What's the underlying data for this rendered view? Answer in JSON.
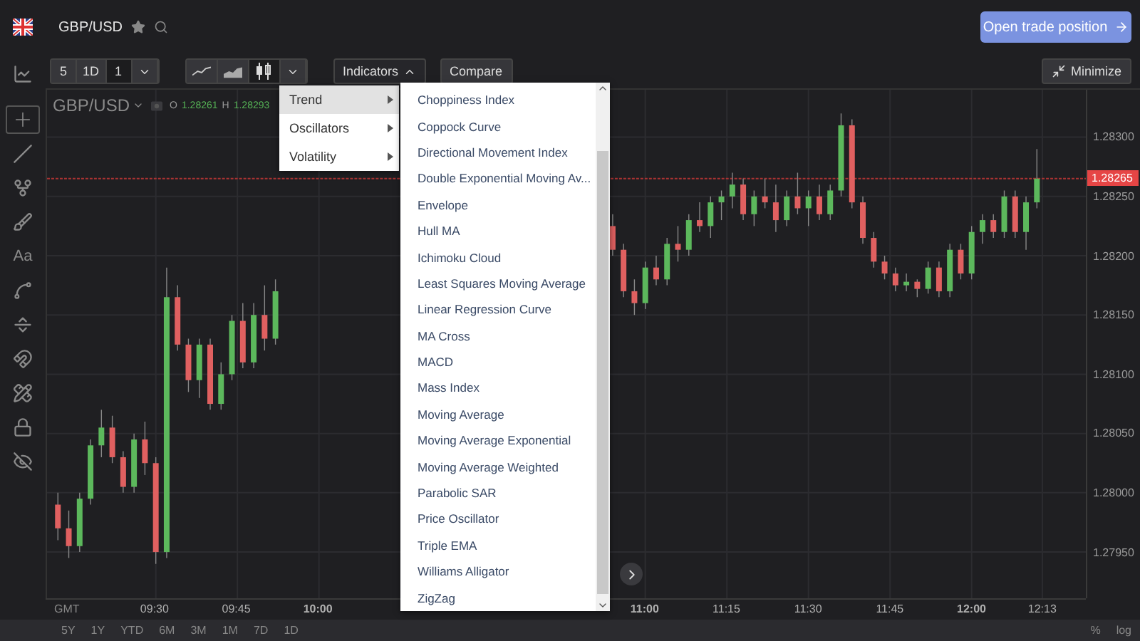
{
  "header": {
    "symbol": "GBP/USD",
    "cta": "Open trade position"
  },
  "toolbar": {
    "intervals": [
      {
        "label": "5",
        "selected": false
      },
      {
        "label": "1D",
        "selected": false
      },
      {
        "label": "1",
        "selected": true
      }
    ],
    "chart_types": [
      {
        "kind": "line",
        "selected": false
      },
      {
        "kind": "area",
        "selected": false
      },
      {
        "kind": "candles",
        "selected": true
      }
    ],
    "indicators": {
      "label": "Indicators",
      "expanded": true
    },
    "compare": "Compare",
    "minimize": "Minimize"
  },
  "tools": [
    {
      "kind": "crosshair",
      "selected": true
    },
    {
      "kind": "line",
      "selected": false
    },
    {
      "kind": "pitchfork",
      "selected": false
    },
    {
      "kind": "brush",
      "selected": false
    },
    {
      "kind": "text",
      "label": "Aa",
      "selected": false
    },
    {
      "kind": "pattern",
      "selected": false
    },
    {
      "kind": "measure",
      "selected": false
    },
    {
      "kind": "magnet",
      "selected": false
    },
    {
      "kind": "stay",
      "selected": false
    },
    {
      "kind": "lock",
      "selected": false
    },
    {
      "kind": "hide",
      "selected": false
    }
  ],
  "legend": {
    "symbol": "GBP/USD",
    "open_label": "O",
    "open": "1.28261",
    "high_label": "H",
    "high": "1.28293"
  },
  "indicator_menu": {
    "categories": [
      {
        "label": "Trend",
        "selected": true
      },
      {
        "label": "Oscillators",
        "selected": false
      },
      {
        "label": "Volatility",
        "selected": false
      }
    ],
    "items": [
      "Choppiness Index",
      "Coppock Curve",
      "Directional Movement Index",
      "Double Exponential Moving Av...",
      "Envelope",
      "Hull MA",
      "Ichimoku Cloud",
      "Least Squares Moving Average",
      "Linear Regression Curve",
      "MA Cross",
      "MACD",
      "Mass Index",
      "Moving Average",
      "Moving Average Exponential",
      "Moving Average Weighted",
      "Parabolic SAR",
      "Price Oscillator",
      "Triple EMA",
      "Williams Alligator",
      "ZigZag"
    ]
  },
  "chart": {
    "current_price": "1.28265",
    "timezone": "GMT",
    "xtick_styles": [
      {
        "bold": false
      },
      {
        "bold": false
      },
      {
        "bold": true
      },
      {
        "bold": true
      },
      {
        "bold": false
      },
      {
        "bold": false
      },
      {
        "bold": false
      },
      {
        "bold": true
      },
      {
        "bold": false
      }
    ],
    "chart_data": {
      "type": "candlestick",
      "grid": true,
      "ref_lines": [
        {
          "axis": "y",
          "value": 1.28265,
          "color": "#aa3333"
        }
      ],
      "xlim": [
        550,
        741
      ],
      "ylim": [
        1.27911,
        1.2834
      ],
      "xticks": [
        {
          "value": 570,
          "label": "09:30"
        },
        {
          "value": 585,
          "label": "09:45"
        },
        {
          "value": 600,
          "label": "10:00"
        },
        {
          "value": 660,
          "label": "11:00"
        },
        {
          "value": 675,
          "label": "11:15"
        },
        {
          "value": 690,
          "label": "11:30"
        },
        {
          "value": 705,
          "label": "11:45"
        },
        {
          "value": 720,
          "label": "12:00"
        },
        {
          "value": 733,
          "label": "12:13"
        }
      ],
      "yticks": [
        {
          "value": 1.283,
          "label": "1.28300"
        },
        {
          "value": 1.2825,
          "label": "1.28250"
        },
        {
          "value": 1.282,
          "label": "1.28200"
        },
        {
          "value": 1.2815,
          "label": "1.28150"
        },
        {
          "value": 1.281,
          "label": "1.28100"
        },
        {
          "value": 1.2805,
          "label": "1.28050"
        },
        {
          "value": 1.28,
          "label": "1.28000"
        },
        {
          "value": 1.2795,
          "label": "1.27950"
        }
      ],
      "x": [
        552,
        554,
        556,
        558,
        560,
        562,
        564,
        566,
        568,
        570,
        572,
        574,
        576,
        578,
        580,
        582,
        584,
        586,
        588,
        590,
        592,
        654,
        656,
        658,
        660,
        662,
        664,
        666,
        668,
        670,
        672,
        674,
        676,
        678,
        680,
        682,
        684,
        686,
        688,
        690,
        692,
        694,
        696,
        698,
        700,
        702,
        704,
        706,
        708,
        710,
        712,
        714,
        716,
        718,
        720,
        722,
        724,
        726,
        728,
        730,
        732
      ],
      "ohlc": [
        [
          1.2799,
          1.28,
          1.2796,
          1.2797
        ],
        [
          1.2797,
          1.27985,
          1.27945,
          1.27955
        ],
        [
          1.27955,
          1.28,
          1.2795,
          1.27995
        ],
        [
          1.27995,
          1.28045,
          1.2799,
          1.2804
        ],
        [
          1.2804,
          1.2807,
          1.2803,
          1.28055
        ],
        [
          1.28055,
          1.28065,
          1.28025,
          1.2803
        ],
        [
          1.2803,
          1.28035,
          1.28,
          1.28005
        ],
        [
          1.28005,
          1.2805,
          1.28,
          1.28045
        ],
        [
          1.28045,
          1.2806,
          1.28015,
          1.28025
        ],
        [
          1.28025,
          1.2803,
          1.2794,
          1.2795
        ],
        [
          1.2795,
          1.2819,
          1.27945,
          1.28165
        ],
        [
          1.28165,
          1.28175,
          1.2812,
          1.28125
        ],
        [
          1.28125,
          1.2813,
          1.28085,
          1.28095
        ],
        [
          1.28095,
          1.2813,
          1.2808,
          1.28125
        ],
        [
          1.28125,
          1.2813,
          1.2807,
          1.28075
        ],
        [
          1.28075,
          1.2811,
          1.2807,
          1.281
        ],
        [
          1.281,
          1.2815,
          1.28095,
          1.28145
        ],
        [
          1.28145,
          1.2816,
          1.28105,
          1.2811
        ],
        [
          1.2811,
          1.2816,
          1.28105,
          1.2815
        ],
        [
          1.2815,
          1.28175,
          1.2812,
          1.2813
        ],
        [
          1.2813,
          1.2818,
          1.28125,
          1.2817
        ],
        [
          1.28225,
          1.28235,
          1.282,
          1.28205
        ],
        [
          1.28205,
          1.2821,
          1.28165,
          1.2817
        ],
        [
          1.2817,
          1.2818,
          1.2815,
          1.2816
        ],
        [
          1.2816,
          1.28195,
          1.28155,
          1.2819
        ],
        [
          1.2819,
          1.282,
          1.28175,
          1.2818
        ],
        [
          1.2818,
          1.28215,
          1.28175,
          1.2821
        ],
        [
          1.2821,
          1.28225,
          1.28195,
          1.28205
        ],
        [
          1.28205,
          1.28235,
          1.282,
          1.2823
        ],
        [
          1.2823,
          1.28245,
          1.2822,
          1.28225
        ],
        [
          1.28225,
          1.2825,
          1.28215,
          1.28245
        ],
        [
          1.28245,
          1.28255,
          1.2823,
          1.2825
        ],
        [
          1.2825,
          1.2827,
          1.2824,
          1.2826
        ],
        [
          1.2826,
          1.28265,
          1.2823,
          1.28235
        ],
        [
          1.28235,
          1.28255,
          1.28225,
          1.2825
        ],
        [
          1.2825,
          1.28265,
          1.2824,
          1.28245
        ],
        [
          1.28245,
          1.2826,
          1.2822,
          1.2823
        ],
        [
          1.2823,
          1.28255,
          1.28225,
          1.2825
        ],
        [
          1.2825,
          1.2827,
          1.28235,
          1.2824
        ],
        [
          1.2824,
          1.28255,
          1.28225,
          1.2825
        ],
        [
          1.2825,
          1.2826,
          1.2823,
          1.28235
        ],
        [
          1.28235,
          1.2826,
          1.2823,
          1.28255
        ],
        [
          1.28255,
          1.2832,
          1.2825,
          1.2831
        ],
        [
          1.2831,
          1.28315,
          1.2824,
          1.28245
        ],
        [
          1.28245,
          1.2825,
          1.2821,
          1.28215
        ],
        [
          1.28215,
          1.2822,
          1.2819,
          1.28195
        ],
        [
          1.28195,
          1.282,
          1.2818,
          1.28185
        ],
        [
          1.28185,
          1.2819,
          1.2817,
          1.28175
        ],
        [
          1.28175,
          1.28185,
          1.2817,
          1.28178
        ],
        [
          1.28178,
          1.2818,
          1.28165,
          1.28172
        ],
        [
          1.28172,
          1.28195,
          1.28168,
          1.2819
        ],
        [
          1.2819,
          1.28195,
          1.28165,
          1.2817
        ],
        [
          1.2817,
          1.2821,
          1.28165,
          1.28205
        ],
        [
          1.28205,
          1.2821,
          1.2818,
          1.28185
        ],
        [
          1.28185,
          1.28225,
          1.2818,
          1.2822
        ],
        [
          1.2822,
          1.28235,
          1.2821,
          1.2823
        ],
        [
          1.2823,
          1.28235,
          1.28215,
          1.2822
        ],
        [
          1.2822,
          1.28255,
          1.28215,
          1.2825
        ],
        [
          1.2825,
          1.28255,
          1.28215,
          1.2822
        ],
        [
          1.2822,
          1.2825,
          1.28205,
          1.28245
        ],
        [
          1.28245,
          1.2829,
          1.2824,
          1.28265
        ]
      ]
    }
  },
  "ranges": [
    "5Y",
    "1Y",
    "YTD",
    "6M",
    "3M",
    "1M",
    "7D",
    "1D"
  ],
  "scale_options": [
    "%",
    "log"
  ]
}
